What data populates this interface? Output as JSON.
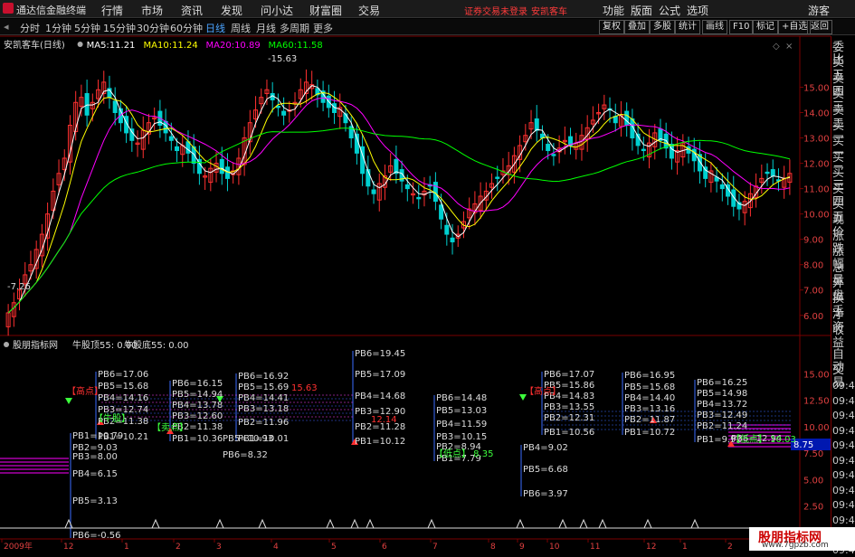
{
  "menubar": {
    "title": "通达信金融终端",
    "items": [
      "行情",
      "市场",
      "资讯",
      "发现",
      "问小达",
      "财富圈",
      "交易"
    ],
    "warning": "证券交易未登录",
    "stock": "安凯客车",
    "right_items": [
      "功能",
      "版面",
      "公式",
      "选项",
      "游客"
    ]
  },
  "periods": [
    "分时",
    "1分钟",
    "5分钟",
    "15分钟",
    "30分钟",
    "60分钟",
    "日线",
    "周线",
    "月线",
    "多周期",
    "更多"
  ],
  "active_period": "日线",
  "right_buttons": [
    "复权",
    "叠加",
    "多股",
    "统计",
    "画线",
    "F10",
    "标记",
    "+自选",
    "返回"
  ],
  "main_legend": {
    "name": "安凯客车(日线)",
    "ma5_label": "MA5:",
    "ma5": "11.21",
    "ma10_label": "MA10:",
    "ma10": "11.24",
    "ma20_label": "MA20:",
    "ma20": "10.89",
    "ma60_label": "MA60:",
    "ma60": "11.58"
  },
  "colors": {
    "up": "#ff3030",
    "down": "#00d0d0",
    "ma5": "#ffffff",
    "ma10": "#ffff00",
    "ma20": "#ff00ff",
    "ma60": "#00ff00",
    "grid": "#7a0000"
  },
  "main_axis": [
    "15.00",
    "14.00",
    "13.00",
    "12.00",
    "11.00",
    "10.00",
    "9.00",
    "8.00",
    "7.00",
    "6.00"
  ],
  "main_annotations": {
    "high": "15.63",
    "low": "7.26"
  },
  "sub_legend": {
    "name": "股朋指标网",
    "top_label": "牛股顶55:",
    "top": "0.00",
    "bottom_label": "牛股底55:",
    "bottom": "0.00"
  },
  "sub_axis": [
    "15.00",
    "12.50",
    "10.00",
    "7.50",
    "5.00",
    "2.50"
  ],
  "sub_price_tag": "8.75",
  "right_panel": [
    "委比",
    "卖五",
    "卖四",
    "卖三",
    "卖二",
    "卖一",
    "买一",
    "买二",
    "买三",
    "买四",
    "买五",
    "现价",
    "涨跌",
    "涨幅",
    "总量",
    "外盘",
    "换手",
    "净资",
    "收益"
  ],
  "right_panel_bottom": [
    "自动",
    "交易"
  ],
  "right_times": [
    "09:48",
    "09:48",
    "09:48",
    "09:48",
    "09:48",
    "09:48",
    "09:48",
    "09:48",
    "09:49",
    "09:49",
    "09:49",
    "09:49"
  ],
  "levels_A": [
    "PB6=17.06",
    "PB5=15.68",
    "PB4=14.16",
    "PB3=12.74",
    "PB2=11.38",
    "PB1=10.21"
  ],
  "levels_B": [
    "PB6=16.15",
    "PB5=14.94",
    "PB4=13.78",
    "PB3=12.60",
    "PB2=11.38",
    "PB1=10.36"
  ],
  "levels_C": [
    "PB6=16.92",
    "PB5=15.69",
    "PB4=14.41",
    "PB3=13.18",
    "PB2=11.96",
    "PB1=10.01"
  ],
  "levels_D": [
    "PB6=19.45",
    "PB5=17.09",
    "PB4=14.68",
    "PB3=12.90",
    "PB2=11.28",
    "PB1=10.12"
  ],
  "levels_E": [
    "PB6=14.48",
    "PB5=13.03",
    "PB4=11.59",
    "PB3=10.15",
    "PB2=8.94",
    "PB1=7.79"
  ],
  "levels_F": [
    "PB1=10.79",
    "PB2=9.03",
    "PB3=8.00",
    "PB4=6.15",
    "PB5=3.13",
    "PB6=-0.56"
  ],
  "levels_G": [
    "PB6=17.07",
    "PB5=15.86",
    "PB4=14.83",
    "PB3=13.55",
    "PB2=12.31",
    "PB1=10.56"
  ],
  "levels_H": [
    "PB4=9.02",
    "PB5=6.68",
    "PB6=3.97"
  ],
  "levels_I": [
    "PB6=16.95",
    "PB5=15.68",
    "PB4=14.40",
    "PB3=13.16",
    "PB2=11.87",
    "PB1=10.72"
  ],
  "levels_J": [
    "PB6=16.25",
    "PB5=14.98",
    "PB4=13.72",
    "PB3=12.49",
    "PB2=11.24",
    "PB1=9.92"
  ],
  "sub_extra": {
    "pb5": "PB5=10.93",
    "pb6": "PB6=8.32",
    "pb6b": "PB6=12.94",
    "low": "8.35",
    "low2": "10.03",
    "high": "15.63",
    "high2": "12.14",
    "tag_high": "【高点】",
    "tag_low": "【低点】",
    "tag_bull": "【牛股】",
    "tag_sell": "【卖点】"
  },
  "x_labels": [
    "2009年",
    "12",
    "1",
    "2",
    "3",
    "4",
    "5",
    "6",
    "7",
    "8",
    "9",
    "10",
    "11",
    "12",
    "1",
    "2",
    "3"
  ],
  "watermark": "股朋指标网",
  "watermark_url": "www.7gpzb.com",
  "chart_data": {
    "type": "candlestick",
    "y_range": [
      5.6,
      16.3
    ],
    "closes": [
      6.1,
      6.5,
      7.0,
      7.6,
      8.0,
      8.6,
      9.2,
      10.0,
      10.9,
      11.6,
      12.2,
      13.5,
      14.4,
      14.6,
      13.9,
      14.4,
      14.9,
      15.2,
      14.6,
      14.0,
      13.6,
      13.2,
      12.9,
      12.8,
      13.3,
      13.6,
      13.8,
      13.5,
      13.2,
      12.9,
      12.5,
      12.7,
      12.4,
      12.0,
      11.6,
      11.5,
      11.8,
      12.0,
      11.6,
      11.4,
      11.7,
      12.2,
      13.0,
      13.6,
      14.1,
      14.6,
      14.9,
      14.5,
      14.2,
      13.9,
      14.1,
      14.4,
      14.9,
      15.2,
      15.1,
      14.7,
      14.4,
      14.2,
      14.0,
      14.2,
      13.6,
      13.0,
      12.4,
      11.6,
      11.1,
      10.8,
      11.2,
      11.5,
      11.9,
      11.6,
      11.3,
      11.0,
      10.8,
      10.6,
      10.9,
      11.1,
      10.5,
      9.8,
      9.2,
      8.9,
      9.2,
      9.7,
      10.2,
      10.4,
      10.7,
      10.9,
      11.2,
      11.4,
      11.7,
      11.9,
      12.3,
      12.7,
      13.1,
      13.6,
      13.3,
      13.0,
      12.5,
      12.3,
      12.6,
      12.9,
      12.7,
      12.8,
      13.1,
      13.4,
      13.7,
      14.0,
      14.3,
      14.1,
      13.6,
      13.9,
      13.5,
      13.0,
      12.7,
      12.5,
      12.8,
      13.2,
      12.9,
      12.6,
      12.2,
      12.5,
      12.8,
      12.4,
      12.1,
      11.7,
      11.4,
      11.7,
      11.3,
      11.0,
      10.7,
      10.3,
      10.2,
      10.5,
      10.8,
      11.1,
      11.4,
      11.6,
      11.5,
      11.3,
      11.4,
      11.6
    ]
  }
}
